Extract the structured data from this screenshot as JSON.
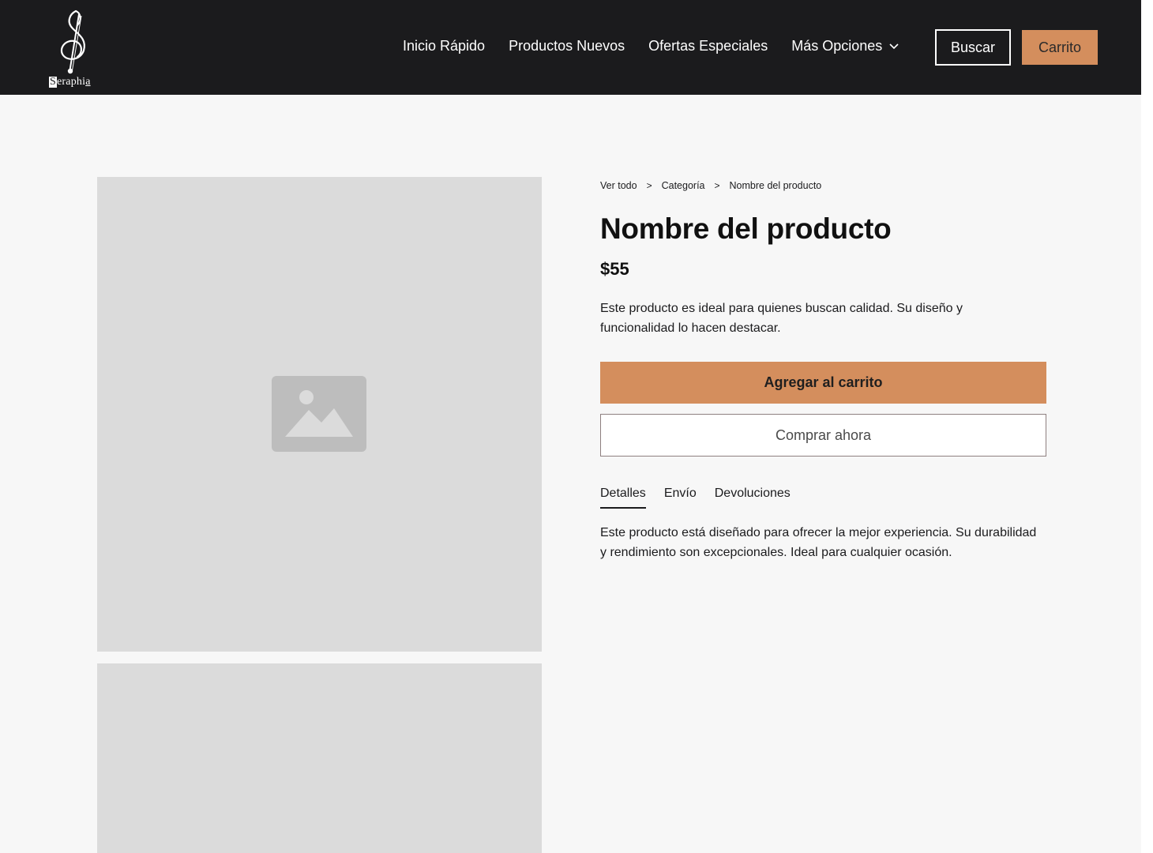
{
  "brand": {
    "logo_text_first": "S",
    "logo_text_rest": "eraphi",
    "logo_text_last": "a"
  },
  "nav": {
    "links": [
      "Inicio Rápido",
      "Productos Nuevos",
      "Ofertas Especiales"
    ],
    "more_label": "Más Opciones",
    "search_label": "Buscar",
    "cart_label": "Carrito"
  },
  "breadcrumb": {
    "items": [
      "Ver todo",
      "Categoría",
      "Nombre del producto"
    ],
    "separator": ">"
  },
  "product": {
    "title": "Nombre del producto",
    "price": "$55",
    "description": "Este producto es ideal para quienes buscan calidad. Su diseño y funcionalidad lo hacen destacar.",
    "add_to_cart_label": "Agregar al carrito",
    "buy_now_label": "Comprar ahora"
  },
  "tabs": {
    "items": [
      "Detalles",
      "Envío",
      "Devoluciones"
    ],
    "active_index": 0,
    "content": "Este producto está diseñado para ofrecer la mejor experiencia. Su durabilidad y rendimiento son excepcionales. Ideal para cualquier ocasión."
  },
  "colors": {
    "header_bg": "#1b1b1d",
    "accent": "#d48e5d",
    "page_bg": "#f7f7f7",
    "image_placeholder": "#dbdbdb"
  },
  "icons": {
    "logo": "treble-clef-logo-icon",
    "dropdown": "chevron-down-icon",
    "image_placeholder": "image-placeholder-icon"
  }
}
